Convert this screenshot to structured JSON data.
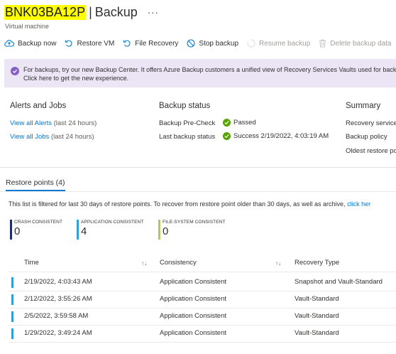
{
  "header": {
    "vm_name": "BNK03BA12P",
    "separator": "|",
    "page_title": "Backup",
    "ellipsis": "···",
    "subtitle": "Virtual machine"
  },
  "toolbar": {
    "backup_now": "Backup now",
    "restore_vm": "Restore VM",
    "file_recovery": "File Recovery",
    "stop_backup": "Stop backup",
    "resume_backup": "Resume backup",
    "delete_backup_data": "Delete backup data"
  },
  "banner": {
    "line1": "For backups, try our new Backup Center. It offers Azure Backup customers a unified view of Recovery Services Vaults used for backup",
    "line2": "Click here to get the new experience."
  },
  "alerts_jobs": {
    "title": "Alerts and Jobs",
    "alerts_link": "View all Alerts",
    "alerts_period": "(last 24 hours)",
    "jobs_link": "View all Jobs",
    "jobs_period": "(last 24 hours)"
  },
  "backup_status": {
    "title": "Backup status",
    "precheck_label": "Backup Pre-Check",
    "precheck_value": "Passed",
    "last_label": "Last backup status",
    "last_value": "Success 2/19/2022, 4:03:19 AM"
  },
  "summary": {
    "title": "Summary",
    "item1": "Recovery service",
    "item2": "Backup policy",
    "item3": "Oldest restore po"
  },
  "restore_points": {
    "tab_label": "Restore points (4)",
    "filter_text": "This list is filtered for last 30 days of restore points. To recover from restore point older than 30 days, as well as archive,",
    "filter_link": "click her",
    "stats": [
      {
        "label": "CRASH CONSISTENT",
        "value": "0",
        "color": "#1f2f6b"
      },
      {
        "label": "APPLICATION CONSISTENT",
        "value": "4",
        "color": "#2fa0d8"
      },
      {
        "label": "FILE-SYSTEM CONSISTENT",
        "value": "0",
        "color": "#b3cc3a"
      }
    ],
    "columns": {
      "time": "Time",
      "consistency": "Consistency",
      "recovery_type": "Recovery Type",
      "sort_glyph": "↑↓"
    },
    "rows": [
      {
        "time": "2/19/2022, 4:03:43 AM",
        "consistency": "Application Consistent",
        "recovery_type": "Snapshot and Vault-Standard"
      },
      {
        "time": "2/12/2022, 3:55:26 AM",
        "consistency": "Application Consistent",
        "recovery_type": "Vault-Standard"
      },
      {
        "time": "2/5/2022, 3:59:58 AM",
        "consistency": "Application Consistent",
        "recovery_type": "Vault-Standard"
      },
      {
        "time": "1/29/2022, 3:49:24 AM",
        "consistency": "Application Consistent",
        "recovery_type": "Vault-Standard"
      }
    ]
  },
  "colors": {
    "accent_blue": "#0078d4",
    "success_green": "#57a300",
    "banner_bg": "#ece5f6",
    "banner_icon": "#8661c5",
    "highlight": "#ffff00"
  }
}
